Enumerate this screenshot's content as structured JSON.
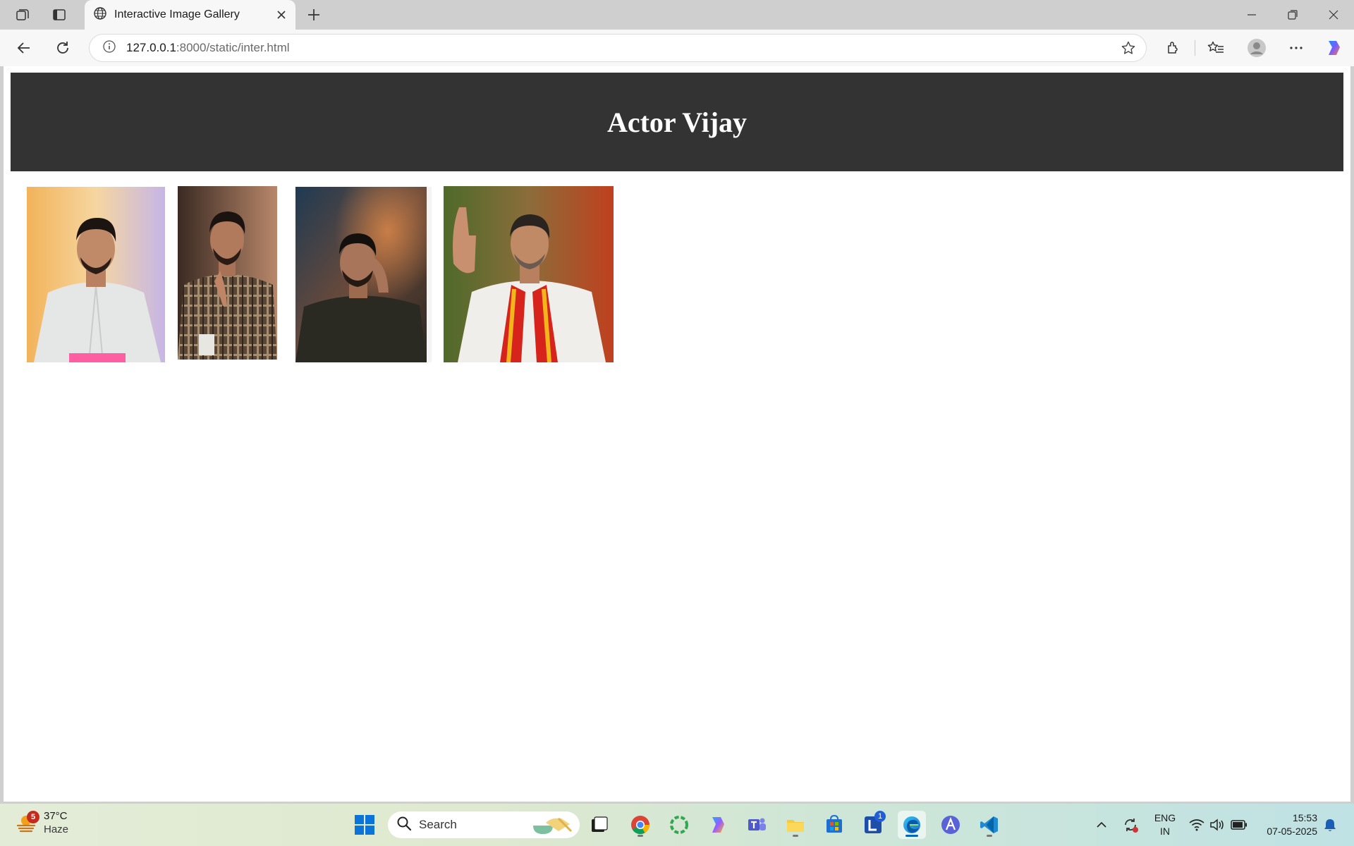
{
  "browser": {
    "tab_title": "Interactive Image Gallery",
    "url_host": "127.0.0.1",
    "url_rest": ":8000/static/inter.html"
  },
  "page": {
    "heading": "Actor Vijay",
    "images": [
      {
        "alt": "Vijay in light linen shirt"
      },
      {
        "alt": "Vijay in checked shirt gesturing"
      },
      {
        "alt": "Vijay on phone in dark jacket"
      },
      {
        "alt": "Vijay waving with red and yellow scarf"
      }
    ]
  },
  "taskbar": {
    "weather_badge": "5",
    "temperature": "37°C",
    "weather": "Haze",
    "search_placeholder": "Search",
    "lang_line1": "ENG",
    "lang_line2": "IN",
    "time": "15:53",
    "date": "07-05-2025",
    "l_app_badge": "1",
    "apps": [
      "start",
      "search",
      "widgets-task",
      "chrome",
      "copilot-ring",
      "copilot",
      "teams",
      "file-explorer",
      "store",
      "l-app",
      "edge",
      "affinity",
      "vscode"
    ]
  },
  "colors": {
    "header_bg": "#333333",
    "page_bg": "#ffffff",
    "accent": "#0067c0"
  }
}
